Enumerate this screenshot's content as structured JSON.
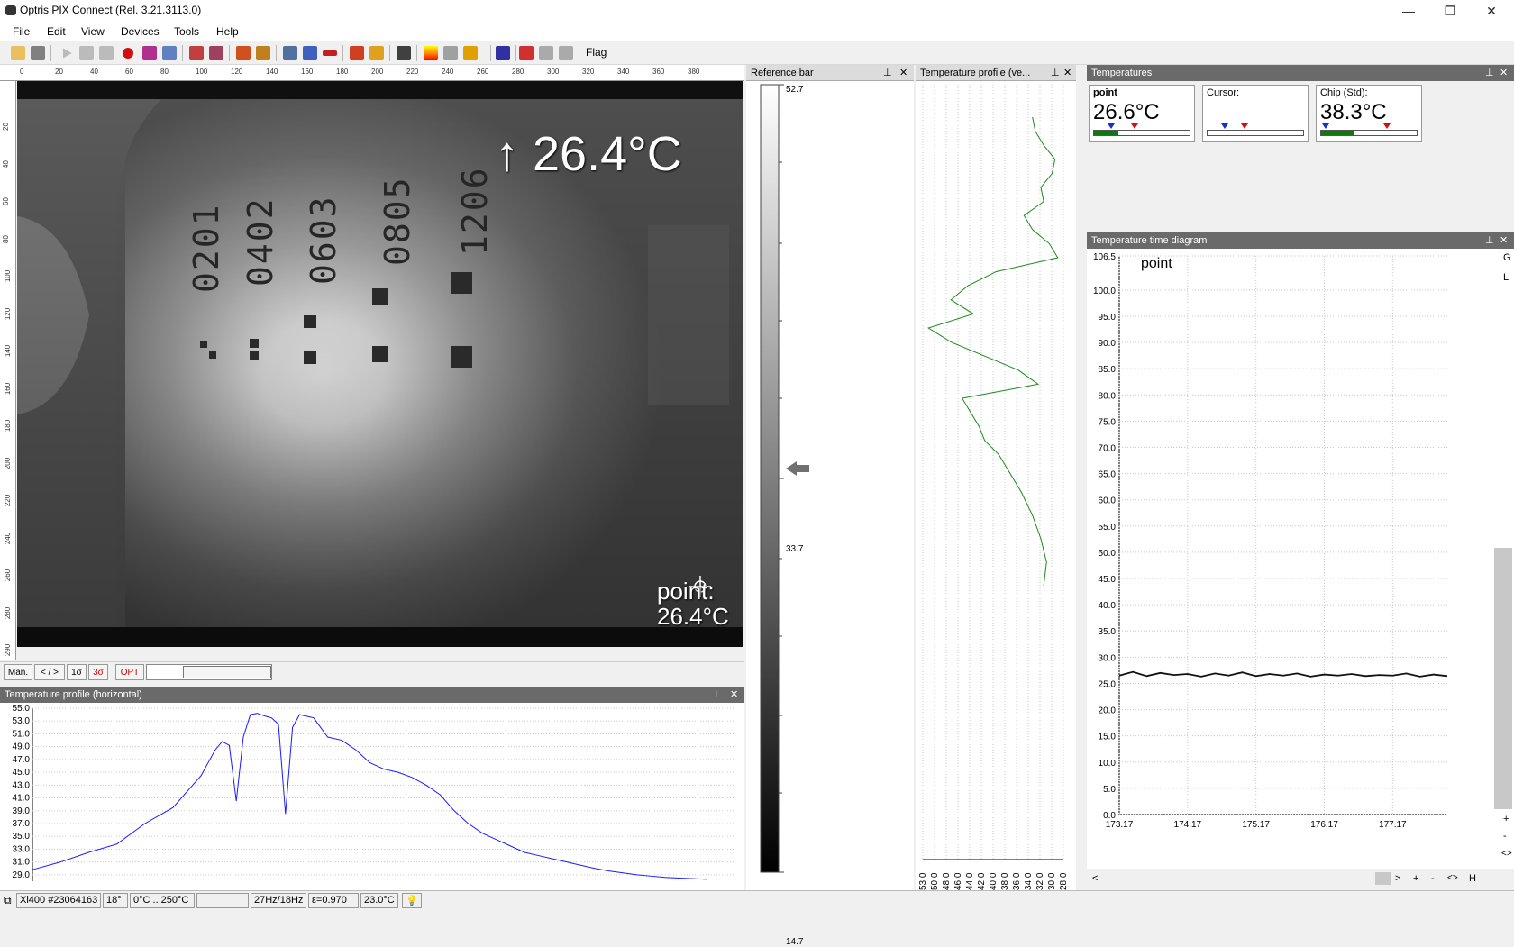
{
  "window": {
    "title": "Optris PIX Connect (Rel. 3.21.3113.0)",
    "min_glyph": "—",
    "restore_glyph": "❐",
    "close_glyph": "✕"
  },
  "menu": [
    "File",
    "Edit",
    "View",
    "Devices",
    "Tools",
    "Help"
  ],
  "toolbar": {
    "flag_label": "Flag"
  },
  "image": {
    "ruler_top": [
      "0",
      "20",
      "40",
      "60",
      "80",
      "100",
      "120",
      "140",
      "160",
      "180",
      "200",
      "220",
      "240",
      "260",
      "280",
      "300",
      "320",
      "340",
      "360",
      "380"
    ],
    "ruler_left": [
      "20",
      "40",
      "60",
      "80",
      "100",
      "120",
      "140",
      "160",
      "180",
      "200",
      "220",
      "240",
      "260",
      "280",
      "290"
    ],
    "chip_labels": [
      "0201",
      "0402",
      "0603",
      "0805",
      "1206"
    ],
    "max_temp": "↑ 26.4°C",
    "point_label_1": "point:",
    "point_label_2": "26.4°C"
  },
  "image_footer": {
    "buttons": [
      "Man.",
      "< / >",
      "1σ",
      "3σ",
      "OPT"
    ]
  },
  "panels": {
    "hprofile": "Temperature profile (horizontal)",
    "refbar": "Reference bar",
    "vprofile": "Temperature profile (ve...",
    "temps": "Temperatures",
    "timediag": "Temperature time diagram",
    "pin_glyph": "📌",
    "close_glyph": "✕"
  },
  "reference_bar": {
    "max": "52.7",
    "mid": "33.7",
    "min": "14.7"
  },
  "temperatures": [
    {
      "label": "point",
      "value": "26.6°C",
      "fill": 0.25,
      "blue": 0.18,
      "red": 0.4
    },
    {
      "label": "Cursor:",
      "value": "",
      "fill": 0,
      "blue": 0.18,
      "red": 0.36
    },
    {
      "label": "Chip (Std):",
      "value": "38.3°C",
      "fill": 0.35,
      "blue": 0.05,
      "red": 0.65
    }
  ],
  "time_diagram": {
    "series_label": "point",
    "side_buttons": [
      "G",
      "L"
    ],
    "right_controls": [
      "+",
      "-",
      "<>"
    ],
    "bottom_controls": [
      "<",
      ">",
      "+",
      "-",
      "<>",
      "H"
    ]
  },
  "status": {
    "device": "Xi400 #23064163",
    "fov": "18°",
    "range": "0°C .. 250°C",
    "blank": "",
    "fps": "27Hz/18Hz",
    "emissivity": "ε=0.970",
    "ambient": "23.0°C"
  },
  "chart_data": [
    {
      "type": "line",
      "name": "hprofile",
      "y_ticks": [
        "55.0",
        "53.0",
        "51.0",
        "49.0",
        "47.0",
        "45.0",
        "43.0",
        "41.0",
        "39.0",
        "37.0",
        "35.0",
        "33.0",
        "31.0",
        "29.0"
      ],
      "ylim": [
        28,
        55
      ],
      "xlim": [
        0,
        100
      ],
      "color": "#1a1aff",
      "series": [
        {
          "x": [
            0,
            4,
            8,
            12,
            16,
            20,
            22,
            24,
            25,
            26,
            27,
            28,
            29,
            30,
            31,
            32,
            33,
            34,
            35,
            36,
            37,
            38,
            40,
            42,
            44,
            46,
            48,
            50,
            52,
            54,
            56,
            58,
            60,
            62,
            64,
            66,
            68,
            70,
            72,
            74,
            76,
            78,
            80,
            82,
            84,
            86,
            88,
            90,
            92,
            94,
            96
          ],
          "y": [
            29.8,
            31,
            32.5,
            33.8,
            37,
            39.5,
            42,
            44.5,
            46.5,
            48.5,
            49.8,
            49.2,
            40.5,
            50.5,
            54,
            54.2,
            53.8,
            53.5,
            52.5,
            38.5,
            52,
            54,
            53.5,
            50.5,
            50,
            48.5,
            46.5,
            45.5,
            45,
            44.2,
            43,
            41.5,
            39,
            37,
            35.5,
            34.5,
            33.5,
            32.5,
            32,
            31.5,
            31,
            30.5,
            30,
            29.6,
            29.3,
            29,
            28.8,
            28.6,
            28.5,
            28.4,
            28.3
          ]
        }
      ]
    },
    {
      "type": "line",
      "name": "vprofile",
      "x_ticks": [
        "53.0",
        "50.0",
        "48.0",
        "46.0",
        "44.0",
        "42.0",
        "40.0",
        "38.0",
        "36.0",
        "34.0",
        "32.0",
        "30.0",
        "28.0"
      ],
      "color": "#1a8a1a",
      "series": [
        {
          "t": [
            0,
            0.03,
            0.06,
            0.09,
            0.12,
            0.15,
            0.18,
            0.21,
            0.24,
            0.27,
            0.3,
            0.33,
            0.36,
            0.39,
            0.42,
            0.45,
            0.48,
            0.51,
            0.54,
            0.57,
            0.6,
            0.63,
            0.66,
            0.69,
            0.72,
            0.75,
            0.8,
            0.85,
            0.9,
            0.95,
            1.0
          ],
          "v": [
            33.5,
            33,
            31.5,
            29.5,
            30,
            32,
            31.5,
            35,
            33.5,
            30.5,
            29,
            40,
            45,
            48,
            44,
            52,
            48,
            42,
            36,
            32.5,
            46,
            44.5,
            43,
            42,
            39.5,
            38,
            35.5,
            33.5,
            32,
            31,
            31.5
          ]
        }
      ]
    },
    {
      "type": "line",
      "name": "time_diagram",
      "y_ticks": [
        "106.5",
        "100.0",
        "95.0",
        "90.0",
        "85.0",
        "80.0",
        "75.0",
        "70.0",
        "65.0",
        "60.0",
        "55.0",
        "50.0",
        "45.0",
        "40.0",
        "35.0",
        "30.0",
        "25.0",
        "20.0",
        "15.0",
        "10.0",
        "5.0",
        "0.0"
      ],
      "x_ticks": [
        "173.17",
        "174.17",
        "175.17",
        "176.17",
        "177.17"
      ],
      "ylim": [
        0,
        106.5
      ],
      "color": "#111111",
      "series": [
        {
          "name": "point",
          "x": [
            173.17,
            173.37,
            173.57,
            173.77,
            173.97,
            174.17,
            174.37,
            174.57,
            174.77,
            174.97,
            175.17,
            175.37,
            175.57,
            175.77,
            175.97,
            176.17,
            176.37,
            176.57,
            176.77,
            176.97,
            177.17,
            177.37,
            177.57,
            177.77,
            177.97
          ],
          "y": [
            26.5,
            27.2,
            26.4,
            27.0,
            26.6,
            26.8,
            26.3,
            26.9,
            26.5,
            27.1,
            26.4,
            26.8,
            26.5,
            26.9,
            26.3,
            26.7,
            26.5,
            26.8,
            26.4,
            26.6,
            26.5,
            26.9,
            26.3,
            26.7,
            26.4
          ]
        }
      ]
    }
  ]
}
